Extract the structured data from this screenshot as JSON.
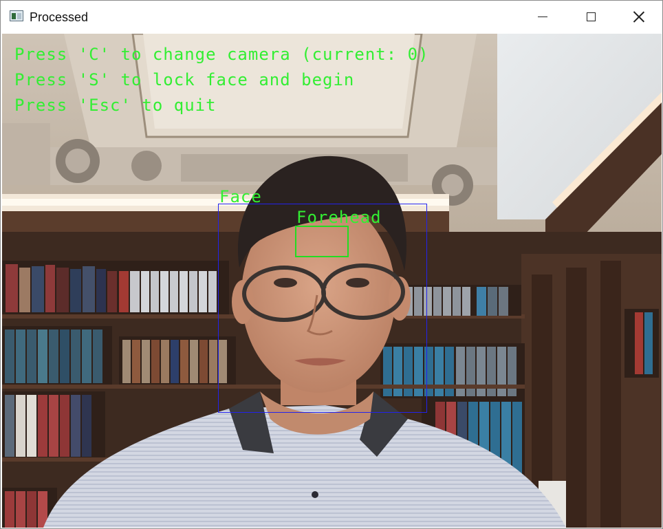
{
  "window": {
    "title": "Processed"
  },
  "overlay": {
    "instructions": [
      "Press 'C' to change camera (current: 0)",
      "Press 'S' to lock face and begin",
      "Press 'Esc' to quit"
    ],
    "face_label": "Face",
    "forehead_label": "Forehead",
    "colors": {
      "text": "#33ee33",
      "face_box": "#2222ee",
      "forehead_box": "#22dd22"
    }
  },
  "icons": [
    "app-icon",
    "minimize-icon",
    "maximize-icon",
    "close-icon"
  ]
}
